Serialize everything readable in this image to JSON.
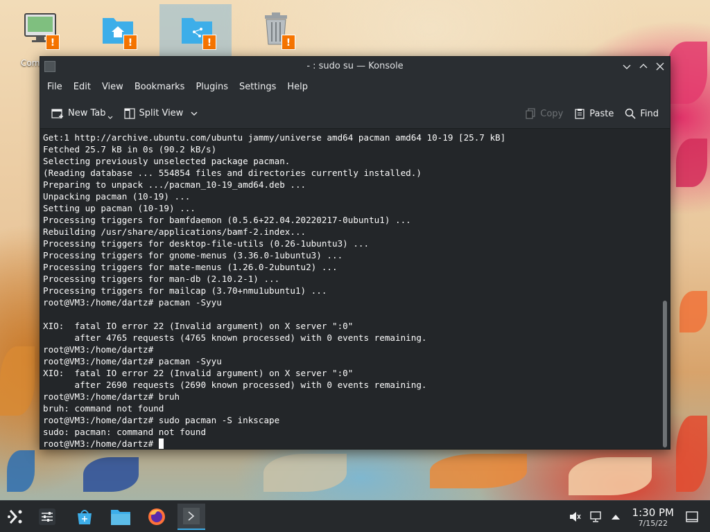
{
  "desktop": {
    "icons": [
      {
        "label": "Comp",
        "icon": "computer-icon"
      },
      {
        "label": "",
        "icon": "home-folder-icon"
      },
      {
        "label": "",
        "icon": "folder-icon"
      },
      {
        "label": "",
        "icon": "trash-icon"
      }
    ],
    "warning_badge": "!"
  },
  "window": {
    "title": "- : sudo su — Konsole",
    "menu": [
      "File",
      "Edit",
      "View",
      "Bookmarks",
      "Plugins",
      "Settings",
      "Help"
    ],
    "toolbar": {
      "new_tab": "New Tab",
      "split_view": "Split View",
      "copy": "Copy",
      "paste": "Paste",
      "find": "Find"
    },
    "terminal_lines": [
      "Get:1 http://archive.ubuntu.com/ubuntu jammy/universe amd64 pacman amd64 10-19 [25.7 kB]",
      "Fetched 25.7 kB in 0s (90.2 kB/s)",
      "Selecting previously unselected package pacman.",
      "(Reading database ... 554854 files and directories currently installed.)",
      "Preparing to unpack .../pacman_10-19_amd64.deb ...",
      "Unpacking pacman (10-19) ...",
      "Setting up pacman (10-19) ...",
      "Processing triggers for bamfdaemon (0.5.6+22.04.20220217-0ubuntu1) ...",
      "Rebuilding /usr/share/applications/bamf-2.index...",
      "Processing triggers for desktop-file-utils (0.26-1ubuntu3) ...",
      "Processing triggers for gnome-menus (3.36.0-1ubuntu3) ...",
      "Processing triggers for mate-menus (1.26.0-2ubuntu2) ...",
      "Processing triggers for man-db (2.10.2-1) ...",
      "Processing triggers for mailcap (3.70+nmu1ubuntu1) ...",
      "root@VM3:/home/dartz# pacman -Syyu",
      "",
      "XIO:  fatal IO error 22 (Invalid argument) on X server \":0\"",
      "      after 4765 requests (4765 known processed) with 0 events remaining.",
      "root@VM3:/home/dartz#",
      "root@VM3:/home/dartz# pacman -Syyu",
      "XIO:  fatal IO error 22 (Invalid argument) on X server \":0\"",
      "      after 2690 requests (2690 known processed) with 0 events remaining.",
      "root@VM3:/home/dartz# bruh",
      "bruh: command not found",
      "root@VM3:/home/dartz# sudo pacman -S inkscape",
      "sudo: pacman: command not found"
    ],
    "prompt": "root@VM3:/home/dartz# "
  },
  "taskbar": {
    "items": [
      {
        "icon": "app-launcher-icon"
      },
      {
        "icon": "system-settings-icon"
      },
      {
        "icon": "discover-store-icon"
      },
      {
        "icon": "file-manager-icon"
      },
      {
        "icon": "firefox-icon"
      },
      {
        "icon": "konsole-icon"
      }
    ],
    "clock_time": "1:30 PM",
    "clock_date": "7/15/22"
  },
  "colors": {
    "accent": "#3daee9",
    "warning": "#f67400",
    "terminal_bg": "#232629",
    "terminal_fg": "#fcfcfc"
  }
}
